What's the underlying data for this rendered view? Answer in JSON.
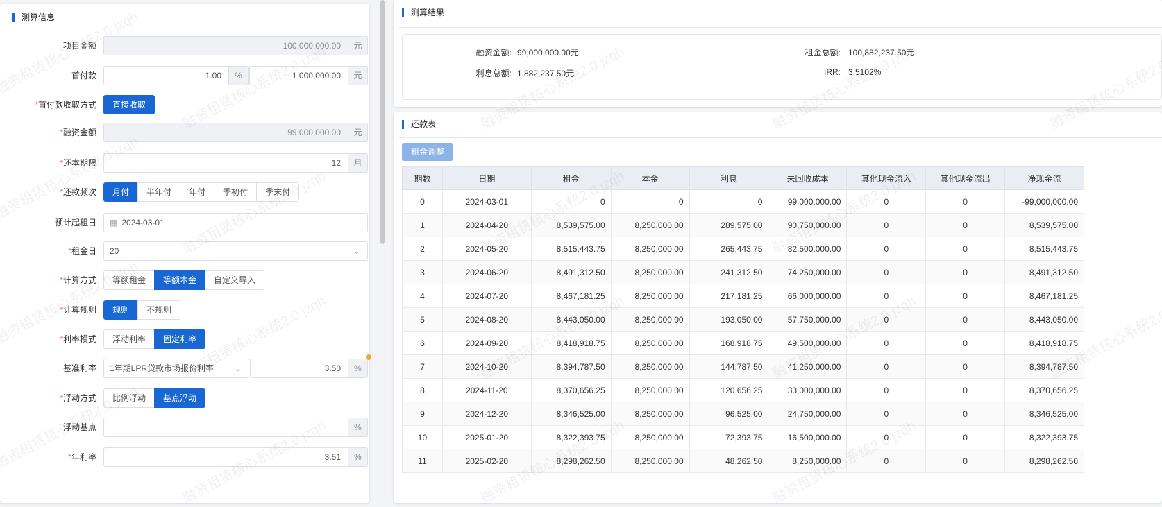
{
  "left": {
    "title": "测算信息",
    "project_amount": {
      "label": "项目金额",
      "value": "100,000,000.00",
      "unit": "元"
    },
    "down_payment": {
      "label": "首付款",
      "percent": "1.00",
      "percent_unit": "%",
      "amount": "1,000,000.00",
      "unit": "元"
    },
    "down_method": {
      "label": "首付款收取方式",
      "button": "直接收取"
    },
    "finance_amount": {
      "label": "融资金额",
      "value": "99,000,000.00",
      "unit": "元"
    },
    "term": {
      "label": "还本期限",
      "value": "12",
      "unit": "月"
    },
    "frequency": {
      "label": "还款频次",
      "options": [
        "月付",
        "半年付",
        "年付",
        "季初付",
        "季末付"
      ]
    },
    "start_date": {
      "label": "预计起租日",
      "value": "2024-03-01"
    },
    "rent_day": {
      "label": "租金日",
      "value": "20"
    },
    "calc_method": {
      "label": "计算方式",
      "options": [
        "等额租金",
        "等额本金",
        "自定义导入"
      ]
    },
    "calc_rule": {
      "label": "计算规则",
      "options": [
        "规则",
        "不规则"
      ]
    },
    "rate_mode": {
      "label": "利率模式",
      "options": [
        "浮动利率",
        "固定利率"
      ]
    },
    "base_rate": {
      "label": "基准利率",
      "select": "1年期LPR贷款市场报价利率",
      "value": "3.50",
      "unit": "%"
    },
    "float_method": {
      "label": "浮动方式",
      "options": [
        "比例浮动",
        "基点浮动"
      ]
    },
    "float_bp": {
      "label": "浮动基点",
      "value": "",
      "unit": "%"
    },
    "annual_rate": {
      "label": "年利率",
      "value": "3.51",
      "unit": "%"
    }
  },
  "result": {
    "title": "测算结果",
    "finance_label": "融资金额:",
    "finance_value": "99,000,000.00元",
    "rent_total_label": "租金总额:",
    "rent_total_value": "100,882,237.50元",
    "interest_label": "利息总额:",
    "interest_value": "1,882,237.50元",
    "irr_label": "IRR:",
    "irr_value": "3.5102%"
  },
  "schedule": {
    "title": "还款表",
    "adjust_button": "租金调整",
    "headers": [
      "期数",
      "日期",
      "租金",
      "本金",
      "利息",
      "未回收成本",
      "其他现金流入",
      "其他现金流出",
      "净现金流"
    ],
    "rows": [
      [
        "0",
        "2024-03-01",
        "0",
        "0",
        "0",
        "99,000,000.00",
        "0",
        "0",
        "-99,000,000.00"
      ],
      [
        "1",
        "2024-04-20",
        "8,539,575.00",
        "8,250,000.00",
        "289,575.00",
        "90,750,000.00",
        "0",
        "0",
        "8,539,575.00"
      ],
      [
        "2",
        "2024-05-20",
        "8,515,443.75",
        "8,250,000.00",
        "265,443.75",
        "82,500,000.00",
        "0",
        "0",
        "8,515,443.75"
      ],
      [
        "3",
        "2024-06-20",
        "8,491,312.50",
        "8,250,000.00",
        "241,312.50",
        "74,250,000.00",
        "0",
        "0",
        "8,491,312.50"
      ],
      [
        "4",
        "2024-07-20",
        "8,467,181.25",
        "8,250,000.00",
        "217,181.25",
        "66,000,000.00",
        "0",
        "0",
        "8,467,181.25"
      ],
      [
        "5",
        "2024-08-20",
        "8,443,050.00",
        "8,250,000.00",
        "193,050.00",
        "57,750,000.00",
        "0",
        "0",
        "8,443,050.00"
      ],
      [
        "6",
        "2024-09-20",
        "8,418,918.75",
        "8,250,000.00",
        "168,918.75",
        "49,500,000.00",
        "0",
        "0",
        "8,418,918.75"
      ],
      [
        "7",
        "2024-10-20",
        "8,394,787.50",
        "8,250,000.00",
        "144,787.50",
        "41,250,000.00",
        "0",
        "0",
        "8,394,787.50"
      ],
      [
        "8",
        "2024-11-20",
        "8,370,656.25",
        "8,250,000.00",
        "120,656.25",
        "33,000,000.00",
        "0",
        "0",
        "8,370,656.25"
      ],
      [
        "9",
        "2024-12-20",
        "8,346,525.00",
        "8,250,000.00",
        "96,525.00",
        "24,750,000.00",
        "0",
        "0",
        "8,346,525.00"
      ],
      [
        "10",
        "2025-01-20",
        "8,322,393.75",
        "8,250,000.00",
        "72,393.75",
        "16,500,000.00",
        "0",
        "0",
        "8,322,393.75"
      ],
      [
        "11",
        "2025-02-20",
        "8,298,262.50",
        "8,250,000.00",
        "48,262.50",
        "8,250,000.00",
        "0",
        "0",
        "8,298,262.50"
      ]
    ]
  },
  "watermark": "融资租赁核心系统2.0 jzqh"
}
